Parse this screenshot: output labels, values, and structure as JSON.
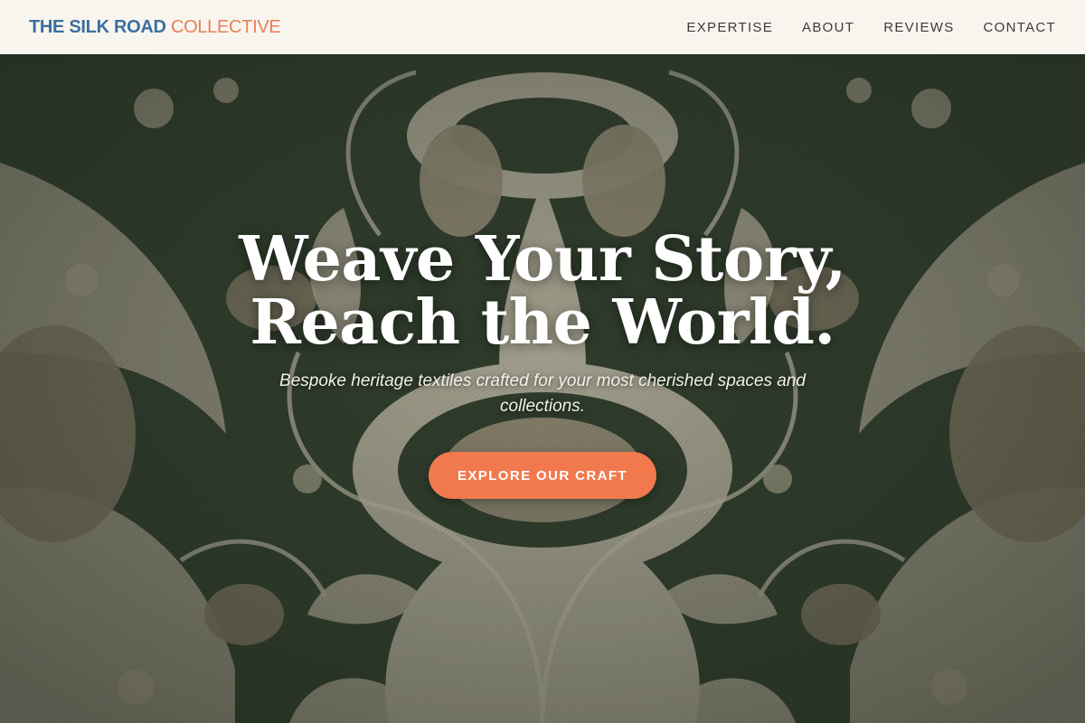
{
  "header": {
    "brand_strong": "THE SILK ROAD",
    "brand_light": "COLLECTIVE",
    "nav": [
      "EXPERTISE",
      "ABOUT",
      "REVIEWS",
      "CONTACT"
    ]
  },
  "hero": {
    "headline_line1": "Weave Your Story,",
    "headline_line2": "Reach the World.",
    "subtitle": "Bespoke heritage textiles crafted for your most cherished spaces and collections.",
    "cta_label": "EXPLORE OUR CRAFT",
    "background_image": "damask-textile-pattern"
  },
  "colors": {
    "brand_blue": "#3b6f9e",
    "brand_orange": "#e8805a",
    "cta": "#f2794e",
    "header_bg": "#f8f5ee",
    "textile_green": "#33402f",
    "textile_cream": "#c9bfae"
  }
}
